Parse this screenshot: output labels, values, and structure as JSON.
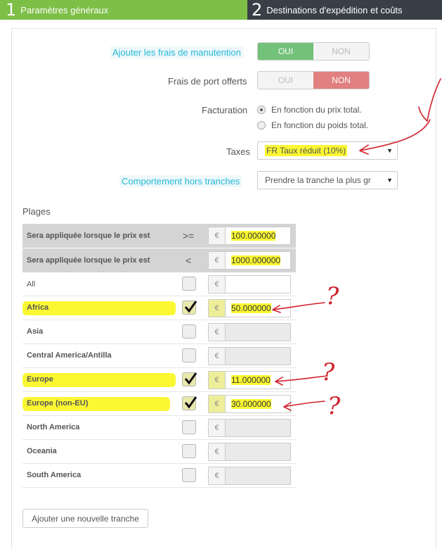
{
  "wizard": {
    "step1": {
      "number": "1",
      "label": "Paramètres généraux"
    },
    "step2": {
      "number": "2",
      "label": "Destinations d'expédition et coûts"
    }
  },
  "form": {
    "handling_label": "Ajouter les frais de manutention",
    "handling_yes": "OUI",
    "handling_no": "NON",
    "handling_value": "OUI",
    "free_shipping_label": "Frais de port offerts",
    "free_yes": "OUI",
    "free_no": "NON",
    "free_value": "NON",
    "billing_label": "Facturation",
    "billing_opt1": "En fonction du prix total.",
    "billing_opt2": "En fonction du poids total.",
    "billing_selected": "En fonction du prix total.",
    "tax_label": "Taxes",
    "tax_value": "FR Taux réduit (10%)",
    "out_of_range_label": "Comportement hors tranches",
    "out_of_range_value": "Prendre la tranche la plus gr"
  },
  "ranges": {
    "title": "Plages",
    "header_rows": [
      {
        "label": "Sera appliquée lorsque le prix est",
        "operator": ">=",
        "currency": "€",
        "value": "100.000000"
      },
      {
        "label": "Sera appliquée lorsque le prix est",
        "operator": "<",
        "currency": "€",
        "value": "1000.000000"
      }
    ],
    "all_row": {
      "label": "All",
      "currency": "€",
      "value": ""
    },
    "zones": [
      {
        "name": "Africa",
        "checked": true,
        "currency": "€",
        "value": "50.000000"
      },
      {
        "name": "Asia",
        "checked": false,
        "currency": "€",
        "value": ""
      },
      {
        "name": "Central America/Antilla",
        "checked": false,
        "currency": "€",
        "value": ""
      },
      {
        "name": "Europe",
        "checked": true,
        "currency": "€",
        "value": "11.000000"
      },
      {
        "name": "Europe (non-EU)",
        "checked": true,
        "currency": "€",
        "value": "30.000000"
      },
      {
        "name": "North America",
        "checked": false,
        "currency": "€",
        "value": ""
      },
      {
        "name": "Oceania",
        "checked": false,
        "currency": "€",
        "value": ""
      },
      {
        "name": "South America",
        "checked": false,
        "currency": "€",
        "value": ""
      }
    ],
    "add_button": "Ajouter une nouvelle tranche"
  },
  "annotations": {
    "question_mark": "?",
    "highlight_color": "#fbf833",
    "pen_color": "#d0202a"
  },
  "colors": {
    "step1_bg": "#7dbf47",
    "step2_bg": "#393f46",
    "toggle_on_green": "#72c279",
    "toggle_on_red": "#e08080",
    "hint_blue": "#25b9d7"
  }
}
